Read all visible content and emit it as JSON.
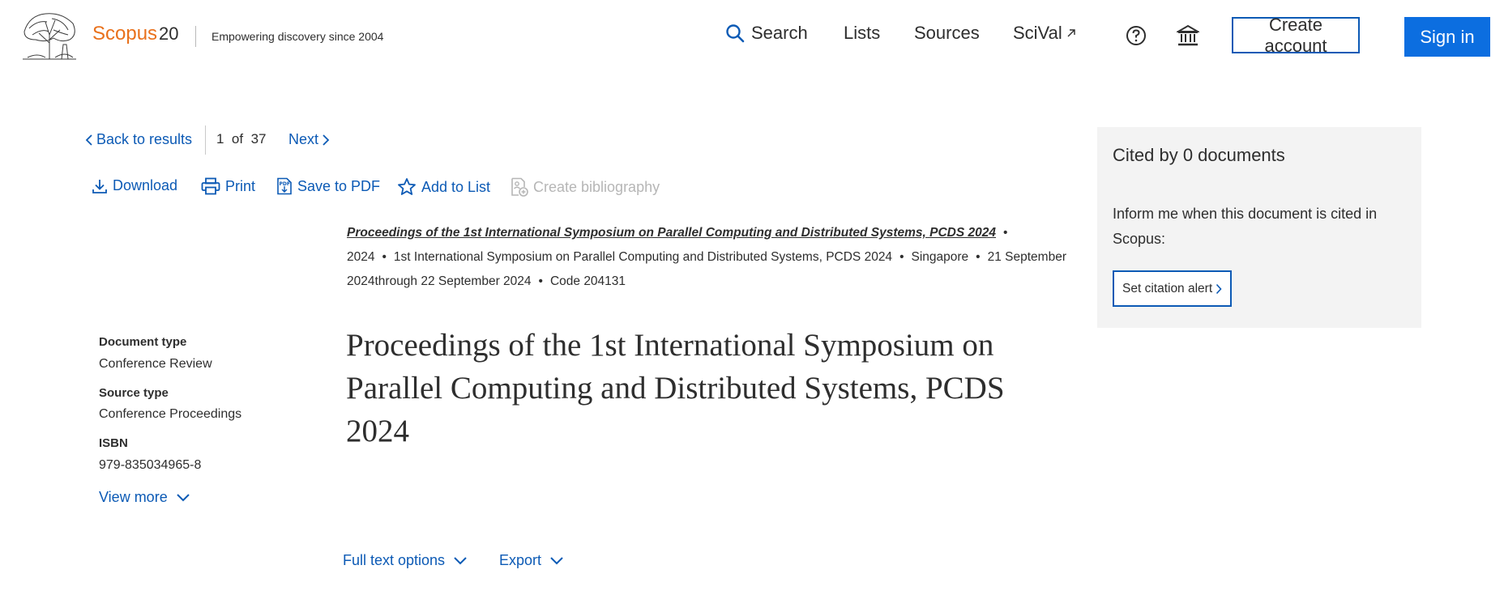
{
  "header": {
    "brand": "Scopus",
    "brand_number": "20",
    "tagline": "Empowering discovery since 2004",
    "nav": {
      "search": "Search",
      "lists": "Lists",
      "sources": "Sources",
      "scival": "SciVal"
    },
    "create_account": "Create account",
    "sign_in": "Sign in"
  },
  "result_nav": {
    "back": "Back to results",
    "current": "1",
    "of": "of",
    "total": "37",
    "next": "Next"
  },
  "toolbar": {
    "download": "Download",
    "print": "Print",
    "save_pdf": "Save to PDF",
    "add_list": "Add to List",
    "create_bibliography": "Create bibliography"
  },
  "source": {
    "title": "Proceedings of the 1st International Symposium on Parallel Computing and Distributed Systems, PCDS 2024",
    "year": "2024",
    "conference": "1st International Symposium on Parallel Computing and Distributed Systems, PCDS 2024",
    "location": "Singapore",
    "dates": "21 September 2024through 22 September 2024",
    "code": "Code 204131"
  },
  "document": {
    "title": "Proceedings of the 1st International Symposium on Parallel Computing and Distributed Systems, PCDS 2024"
  },
  "meta": {
    "document_type_label": "Document type",
    "document_type": "Conference Review",
    "source_type_label": "Source type",
    "source_type": "Conference Proceedings",
    "isbn_label": "ISBN",
    "isbn": "979-835034965-8",
    "view_more": "View more"
  },
  "actions": {
    "full_text": "Full text options",
    "export": "Export"
  },
  "cited": {
    "title": "Cited by 0 documents",
    "text": "Inform me when this document is cited in Scopus:",
    "button": "Set citation alert"
  },
  "colors": {
    "link": "#0c5ab5",
    "brand_orange": "#e9711c",
    "signin_bg": "#0c6ee0",
    "panel_bg": "#f3f3f3",
    "disabled": "#b6b6b6"
  },
  "icons": [
    "elsevier-tree-logo",
    "search-icon",
    "external-arrow-icon",
    "help-icon",
    "institution-icon",
    "chevron-left-icon",
    "chevron-right-icon",
    "download-icon",
    "print-icon",
    "pdf-icon",
    "star-icon",
    "bibliography-icon",
    "chevron-down-icon"
  ]
}
